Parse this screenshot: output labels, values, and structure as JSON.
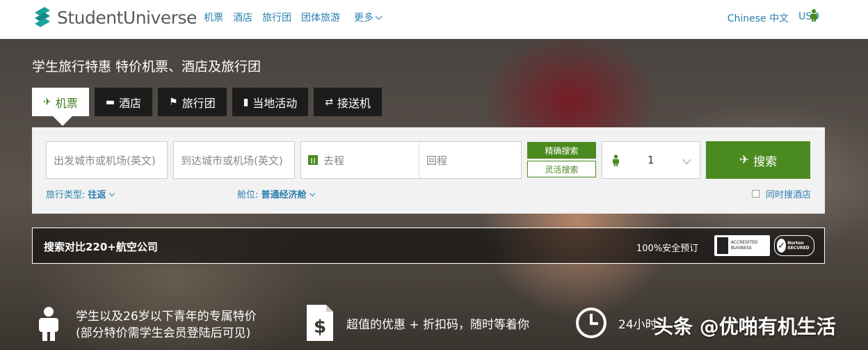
{
  "header": {
    "logo_text": "StudentUniverse",
    "nav": [
      "机票",
      "酒店",
      "旅行团",
      "团体旅游"
    ],
    "more_label": "更多",
    "language": "Chinese 中文",
    "currency": "USD",
    "user_icon": "person-icon"
  },
  "hero": {
    "title": "学生旅行特惠 特价机票、酒店及旅行团"
  },
  "tabs": [
    {
      "label": "机票",
      "icon": "plane-icon",
      "active": true
    },
    {
      "label": "酒店",
      "icon": "bed-icon"
    },
    {
      "label": "旅行团",
      "icon": "flag-icon"
    },
    {
      "label": "当地活动",
      "icon": "ticket-icon"
    },
    {
      "label": "接送机",
      "icon": "transfer-icon"
    }
  ],
  "search": {
    "from_placeholder": "出发城市或机场(英文)",
    "to_placeholder": "到达城市或机场(英文)",
    "depart_placeholder": "去程",
    "return_placeholder": "回程",
    "exact_label": "精确搜索",
    "flex_label": "灵活搜索",
    "passengers": "1",
    "search_label": "搜索",
    "trip_type_label": "旅行类型:",
    "trip_type_value": "往返",
    "cabin_label": "舱位:",
    "cabin_value": "普通经济舱",
    "hotel_checkbox_label": "同时搜酒店"
  },
  "compare": {
    "text": "搜索对比220+航空公司",
    "secure_text": "100%安全预订",
    "bbb_text": "ACCREDITED BUSINESS",
    "norton_text": "Norton SECURED"
  },
  "features": {
    "f1_line1": "学生以及26岁以下青年的专属特价",
    "f1_line2": "(部分特价需学生会员登陆后可见)",
    "f2": "超值的优惠 + 折扣码，随时等着你",
    "f3": "24小时"
  },
  "watermark": "头条 @优啪有机生活",
  "colors": {
    "brand_green": "#4b8a1f",
    "link_blue": "#2a7fb0",
    "logo_teal": "#1aa19a"
  }
}
